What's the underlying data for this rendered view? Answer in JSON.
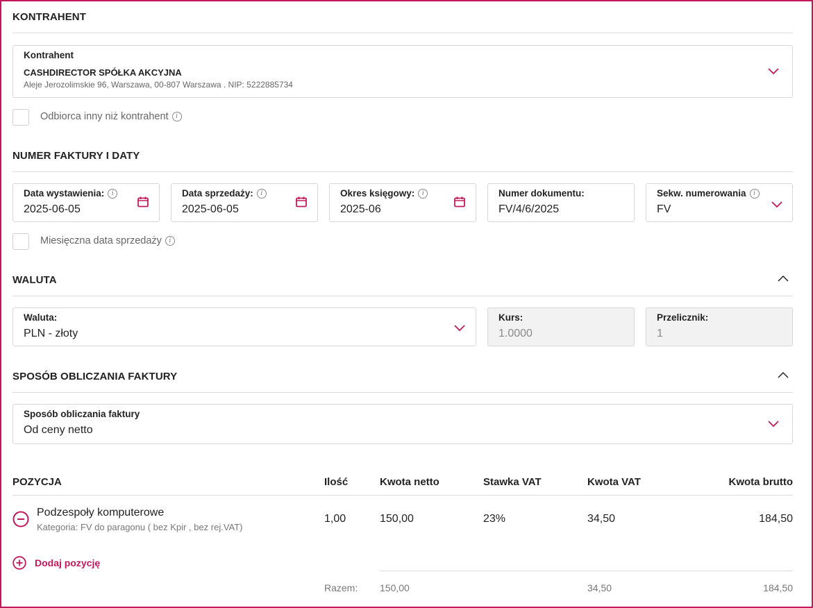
{
  "sections": {
    "contractor": "KONTRAHENT",
    "invoice_number": "NUMER FAKTURY I DATY",
    "currency": "WALUTA",
    "calc_method": "SPOSÓB OBLICZANIA FAKTURY"
  },
  "contractor": {
    "label": "Kontrahent",
    "name": "CASHDIRECTOR SPÓŁKA AKCYJNA",
    "address": "Aleje Jerozolimskie 96, Warszawa, 00-807 Warszawa . NIP: 5222885734",
    "other_recipient_label": "Odbiorca inny niż kontrahent"
  },
  "dates": {
    "issue_label": "Data wystawienia:",
    "issue_value": "2025-06-05",
    "sale_label": "Data sprzedaży:",
    "sale_value": "2025-06-05",
    "period_label": "Okres księgowy:",
    "period_value": "2025-06",
    "docnum_label": "Numer dokumentu:",
    "docnum_value": "FV/4/6/2025",
    "seq_label": "Sekw. numerowania",
    "seq_value": "FV",
    "monthly_label": "Miesięczna data sprzedaży"
  },
  "currency": {
    "label": "Waluta:",
    "value": "PLN - złoty",
    "rate_label": "Kurs:",
    "rate_value": "1.0000",
    "conv_label": "Przelicznik:",
    "conv_value": "1"
  },
  "calc": {
    "label": "Sposób obliczania faktury",
    "value": "Od ceny netto"
  },
  "table": {
    "headers": {
      "position": "POZYCJA",
      "qty": "Ilość",
      "net": "Kwota netto",
      "vat_rate": "Stawka VAT",
      "vat": "Kwota VAT",
      "gross": "Kwota brutto"
    },
    "rows": [
      {
        "name": "Podzespoły komputerowe",
        "category": "Kategoria: FV do paragonu ( bez Kpir , bez rej.VAT)",
        "qty": "1,00",
        "net": "150,00",
        "vat_rate": "23%",
        "vat": "34,50",
        "gross": "184,50"
      }
    ],
    "add_label": "Dodaj pozycję",
    "totals_label": "Razem:",
    "totals": {
      "net": "150,00",
      "vat": "34,50",
      "gross": "184,50"
    }
  },
  "colors": {
    "accent": "#c2185b",
    "border": "#d7d7d7",
    "disabled_bg": "#f2f2f2"
  }
}
